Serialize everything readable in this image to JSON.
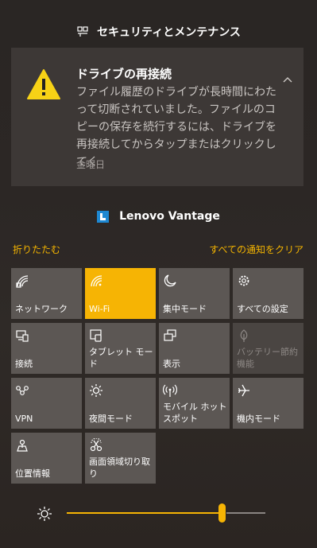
{
  "security_header": {
    "title": "セキュリティとメンテナンス",
    "icon": "flag-icon"
  },
  "notification": {
    "title": "ドライブの再接続",
    "body": "ファイル履歴のドライブが長時間にわたって切断されていました。ファイルのコピーの保存を続行するには、ドライブを再接続してからタップまたはクリックしてく",
    "time": "金曜日",
    "icon": "warning-icon"
  },
  "lenovo_header": {
    "title": "Lenovo Vantage"
  },
  "actions": {
    "collapse": "折りたたむ",
    "clear_all": "すべての通知をクリア"
  },
  "tiles": [
    {
      "label": "ネットワーク",
      "icon": "network-icon",
      "state": "normal"
    },
    {
      "label": "Wi-Fi",
      "icon": "wifi-icon",
      "state": "active"
    },
    {
      "label": "集中モード",
      "icon": "moon-icon",
      "state": "normal"
    },
    {
      "label": "すべての設定",
      "icon": "gear-icon",
      "state": "normal"
    },
    {
      "label": "接続",
      "icon": "connect-icon",
      "state": "normal"
    },
    {
      "label": "タブレット モード",
      "icon": "tablet-icon",
      "state": "normal"
    },
    {
      "label": "表示",
      "icon": "project-icon",
      "state": "normal"
    },
    {
      "label": "バッテリー節約機能",
      "icon": "battery-saver-icon",
      "state": "disabled"
    },
    {
      "label": "VPN",
      "icon": "vpn-icon",
      "state": "normal"
    },
    {
      "label": "夜間モード",
      "icon": "night-light-icon",
      "state": "normal"
    },
    {
      "label": "モバイル ホットスポット",
      "icon": "hotspot-icon",
      "state": "normal"
    },
    {
      "label": "機内モード",
      "icon": "airplane-icon",
      "state": "normal"
    },
    {
      "label": "位置情報",
      "icon": "location-icon",
      "state": "normal"
    },
    {
      "label": "画面領域切り取り",
      "icon": "snip-icon",
      "state": "normal"
    }
  ],
  "brightness": {
    "value": 0.78,
    "icon": "brightness-icon"
  },
  "colors": {
    "accent": "#f6b404",
    "tile": "#5c5754",
    "tile_disabled": "#4a4542",
    "notification_bg": "#3d3836"
  }
}
